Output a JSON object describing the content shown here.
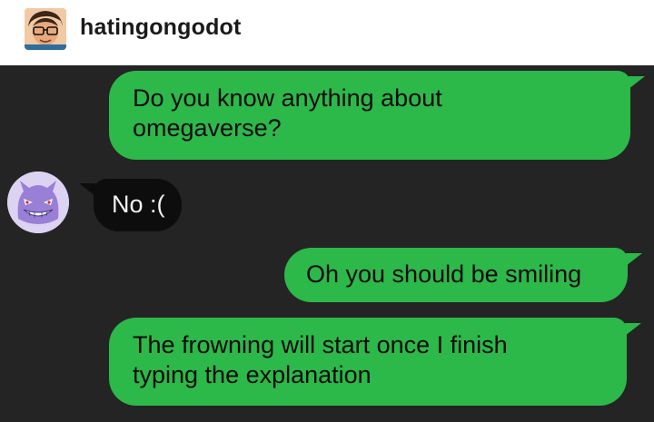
{
  "header": {
    "username": "hatingongodot"
  },
  "messages": [
    {
      "direction": "outgoing",
      "lines": [
        "Do you know anything about",
        "omegaverse?"
      ]
    },
    {
      "direction": "incoming",
      "lines": [
        "No :("
      ]
    },
    {
      "direction": "outgoing",
      "lines": [
        "Oh you should be smiling"
      ]
    },
    {
      "direction": "outgoing",
      "lines": [
        "The frowning will start once I finish",
        "typing the explanation"
      ]
    }
  ],
  "colors": {
    "outgoing_bubble": "#2db84a",
    "incoming_bubble": "#0d0d0d",
    "chat_background": "#242424"
  },
  "icons": {
    "user_avatar": "cartoon-face-with-glasses-icon",
    "contact_avatar": "purple-ghost-gengar-icon"
  }
}
